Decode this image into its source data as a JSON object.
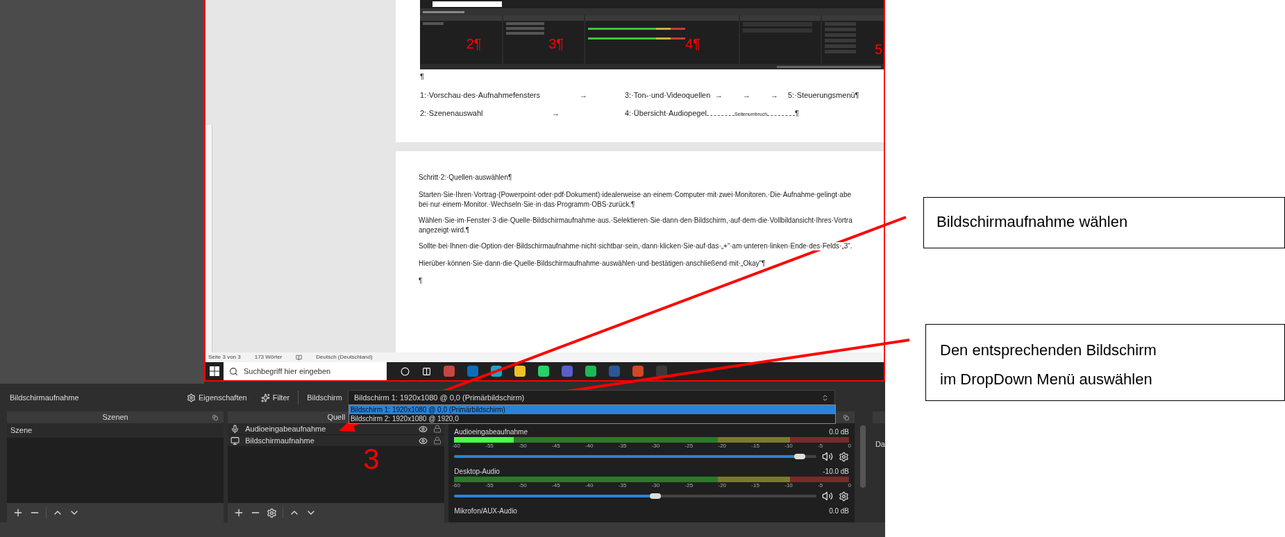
{
  "preview": {
    "word": {
      "embedded_obs": {
        "docks": [
          {
            "kind": "list",
            "marker": "2¶"
          },
          {
            "kind": "sources",
            "marker": "3¶"
          },
          {
            "kind": "mixer",
            "marker": "4¶"
          },
          {
            "kind": "transitions"
          },
          {
            "kind": "controls",
            "marker": "5"
          }
        ]
      },
      "page1_mark": "¶",
      "page1_lines": [
        [
          "1:·Vorschau·des·Aufnahmefensters",
          "→",
          "3:·Ton-·und·Videoquellen",
          "→",
          "→",
          "→",
          "5:·Steuerungsmenü¶"
        ],
        [
          "2:·Szenenauswahl",
          "→",
          "4:·Übersicht·Audiopegel",
          "Seitenumbruch",
          "¶"
        ]
      ],
      "page2_lines": [
        "Schritt·2:·Quellen·auswählen¶",
        "Starten·Sie·Ihren·Vortrag·(Powerpoint·oder·pdf·Dokument)·idealerweise·an·einem·Computer·mit·zwei·Monitoren.·Die·Aufnahme·gelingt·abe",
        "bei·nur·einem·Monitor.·Wechseln·Sie·in·das·Programm·OBS·zurück.¶",
        "Wählen·Sie·im·Fenster·3·die·Quelle·Bildschirmaufnahme·aus.·Selektieren·Sie·dann·den·Bildschirm,·auf·dem·die·Vollbildansicht·Ihres·Vortra",
        "angezeigt·wird.¶",
        "Sollte·bei·Ihnen·die·Option·der·Bildschirmaufnahme·nicht·sichtbar·sein,·dann·klicken·Sie·auf·das·„+“·am·unteren·linken·Ende·des·Felds·„3“.",
        "Hierüber·können·Sie·dann·die·Quelle·Bildschirmaufnahme·auswählen·und·bestätigen·anschließend·mit·„Okay“¶",
        "¶"
      ],
      "status_bar": [
        "Seite 3 von 3",
        "173 Wörter",
        "Deutsch (Deutschland)"
      ]
    },
    "taskbar": {
      "search_placeholder": "Suchbegriff hier eingeben",
      "apps": [
        {
          "color": "#c7463f"
        },
        {
          "color": "#0f6cbd"
        },
        {
          "color": "#1fa3c8"
        },
        {
          "color": "#f2c028"
        },
        {
          "color": "#25d366"
        },
        {
          "color": "#5b5fc7"
        },
        {
          "color": "#1db954"
        },
        {
          "color": "#2b5797"
        },
        {
          "color": "#d24726"
        },
        {
          "color": "#3a3a3a"
        }
      ]
    }
  },
  "source_toolbar": {
    "source_name": "Bildschirmaufnahme",
    "properties": "Eigenschaften",
    "filters": "Filter",
    "field_label": "Bildschirm",
    "dropdown_value": "Bildschirm 1: 1920x1080 @ 0,0 (Primärbildschirm)",
    "options": [
      {
        "label": "Bildschirm 1: 1920x1080 @ 0,0 (Primärbildschirm)",
        "selected": true
      },
      {
        "label": "Bildschirm 2: 1920x1080 @ 1920,0",
        "selected": false
      }
    ]
  },
  "scenes": {
    "title": "Szenen",
    "items": [
      {
        "label": "Szene"
      }
    ]
  },
  "sources": {
    "title": "Quell",
    "items": [
      {
        "kind": "audio",
        "label": "Audioeingabeaufnahme"
      },
      {
        "kind": "display",
        "label": "Bildschirmaufnahme"
      }
    ]
  },
  "mixer": {
    "channels": [
      {
        "name": "Audioeingabeaufnahme",
        "reading": "0.0 dB",
        "meter": {
          "level": 0.15
        },
        "scale": [
          "-60",
          "-55",
          "-50",
          "-45",
          "-40",
          "-35",
          "-30",
          "-25",
          "-20",
          "-15",
          "-10",
          "-5",
          "0"
        ],
        "volume": {
          "level": 0.97
        }
      },
      {
        "name": "Desktop-Audio",
        "reading": "-10.0 dB",
        "meter": {
          "level": 0
        },
        "scale": [
          "-60",
          "-55",
          "-50",
          "-45",
          "-40",
          "-35",
          "-30",
          "-25",
          "-20",
          "-15",
          "-10",
          "-5",
          "0"
        ],
        "volume": {
          "level": 0.57
        }
      }
    ],
    "cut_channel": {
      "name": "Mikrofon/AUX-Audio",
      "reading": "0.0 dB"
    }
  },
  "next_dock_fragment": "Da",
  "annotations": {
    "number_label": "3",
    "callouts": [
      {
        "lines": [
          "Bildschirmaufnahme wählen"
        ]
      },
      {
        "lines": [
          "Den entsprechenden Bildschirm",
          "im DropDown Menü auswählen"
        ]
      }
    ]
  }
}
